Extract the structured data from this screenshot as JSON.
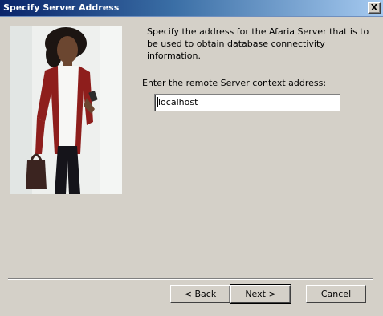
{
  "window": {
    "title": "Specify Server Address",
    "close_label": "X"
  },
  "content": {
    "description": "Specify the address for the Afaria Server that is to be used to obtain database connectivity information.",
    "prompt": "Enter the remote Server context address:",
    "server_address_value": "localhost"
  },
  "buttons": {
    "back": "< Back",
    "next": "Next >",
    "cancel": "Cancel"
  }
}
